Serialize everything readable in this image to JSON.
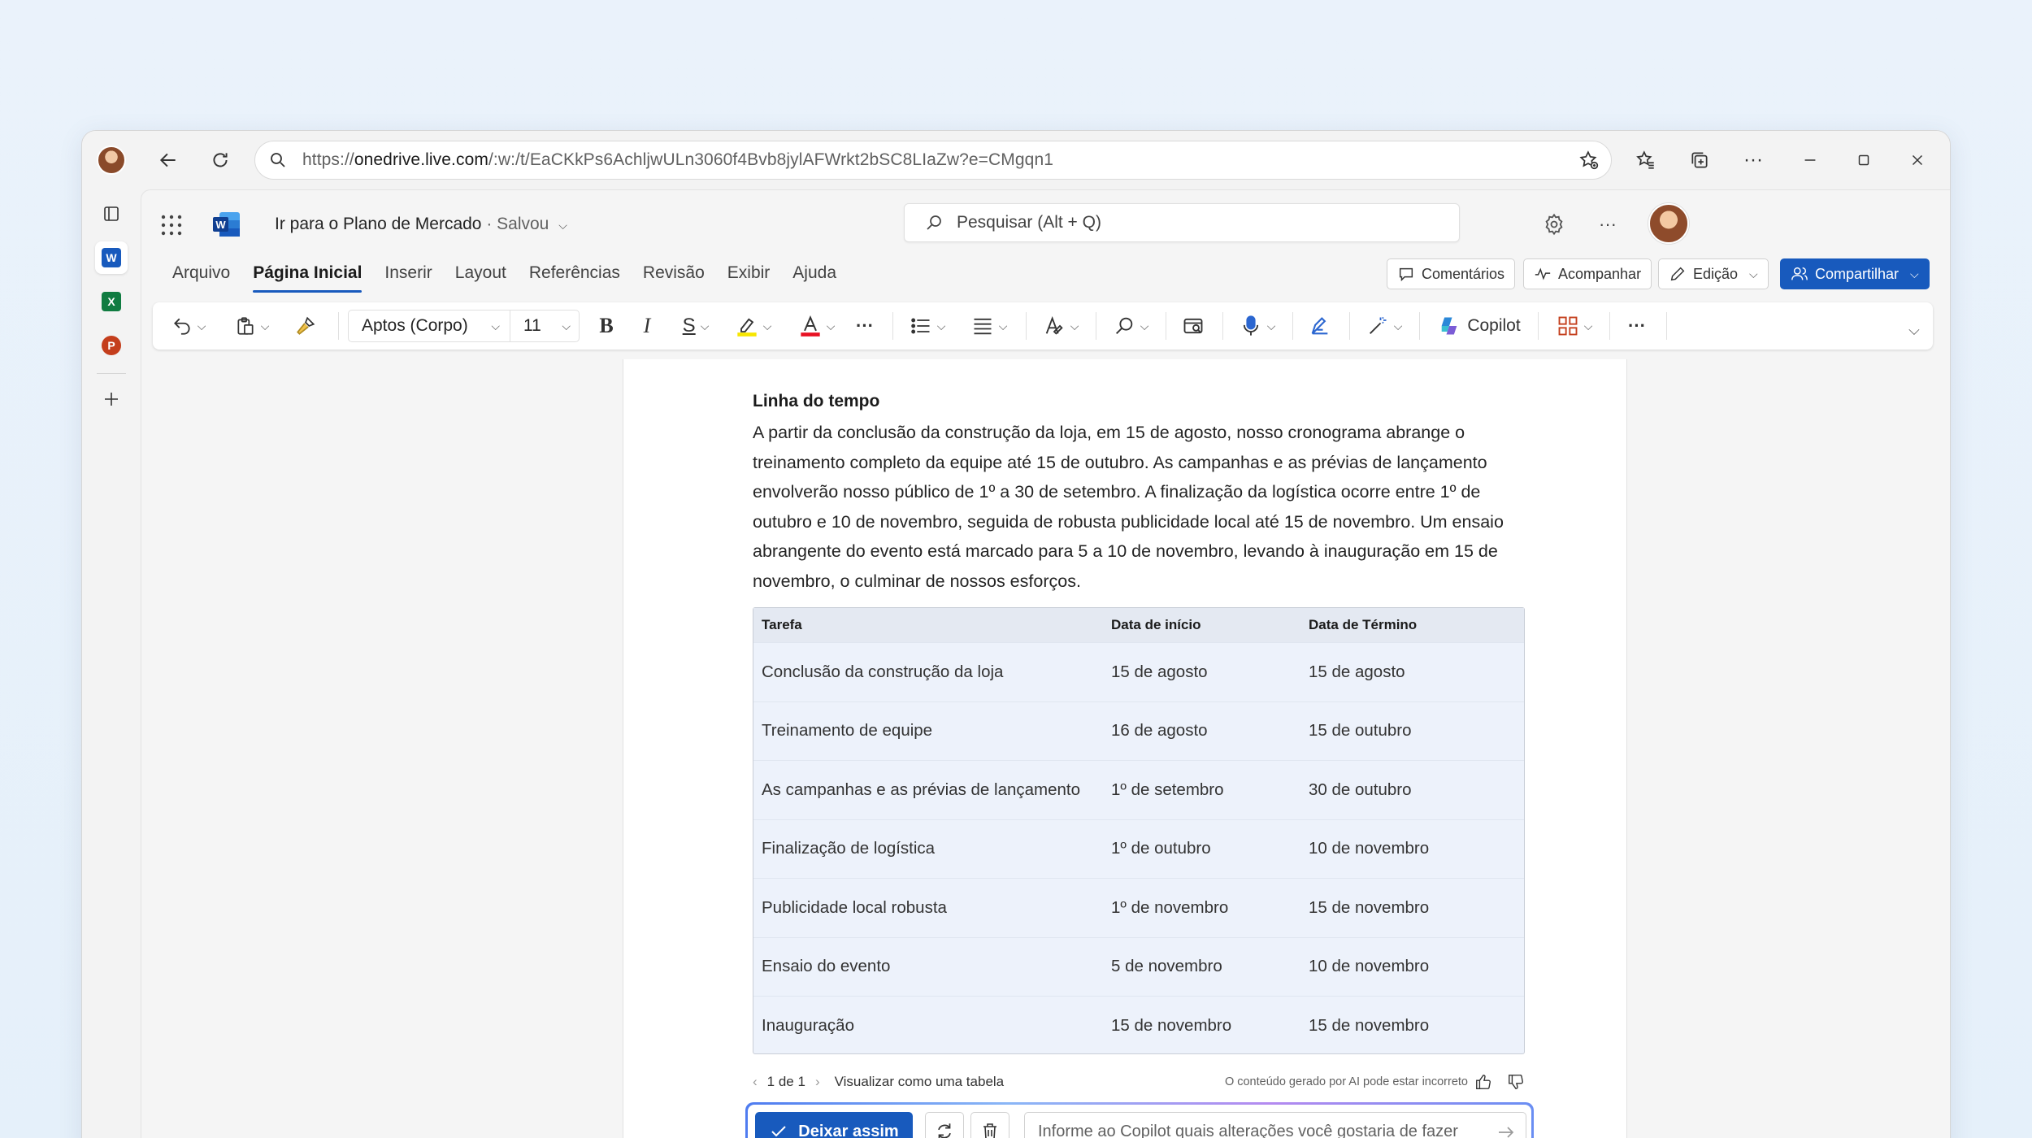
{
  "browser": {
    "url_prefix": "https://",
    "url_domain": "onedrive.live.com",
    "url_rest": "/:w:/t/EaCKkPs6AchljwULn3060f4Bvb8jylAFWrkt2bSC8LIaZw?e=CMgqn1"
  },
  "app": {
    "doc_title": "Ir para o Plano de Mercado",
    "saved_status": "· Salvou",
    "search_placeholder": "Pesquisar (Alt + Q)"
  },
  "menu": {
    "tabs": [
      "Arquivo",
      "Página Inicial",
      "Inserir",
      "Layout",
      "Referências",
      "Revisão",
      "Exibir",
      "Ajuda"
    ],
    "comments": "Comentários",
    "follow": "Acompanhar",
    "editing": "Edição",
    "share": "Compartilhar"
  },
  "toolbar": {
    "font_name": "Aptos (Corpo)",
    "font_size": "11",
    "copilot": "Copilot"
  },
  "document": {
    "heading": "Linha do tempo",
    "paragraph": "A partir da conclusão da construção da loja, em 15 de agosto, nosso cronograma abrange o treinamento completo da equipe até 15 de outubro. As campanhas e as prévias de lançamento envolverão nosso público de 1º a 30 de setembro. A finalização da logística ocorre entre 1º de outubro e 10 de novembro, seguida de robusta publicidade local até 15 de novembro. Um ensaio abrangente do evento está marcado para 5 a 10 de novembro, levando à inauguração em 15 de novembro, o culminar de nossos esforços.",
    "table": {
      "headers": [
        "Tarefa",
        "Data de início",
        "Data de Término"
      ],
      "rows": [
        [
          "Conclusão da construção da loja",
          "15 de agosto",
          "15 de agosto"
        ],
        [
          "Treinamento de equipe",
          "16 de agosto",
          "15 de outubro"
        ],
        [
          "As campanhas e as prévias de lançamento",
          "1º de setembro",
          "30 de outubro"
        ],
        [
          "Finalização de logística",
          "1º de outubro",
          "10 de novembro"
        ],
        [
          "Publicidade local robusta",
          "1º de novembro",
          "15 de novembro"
        ],
        [
          "Ensaio do evento",
          "5 de novembro",
          "10 de novembro"
        ],
        [
          "Inauguração",
          "15 de novembro",
          "15 de novembro"
        ]
      ]
    }
  },
  "copilot": {
    "pager": "1 de 1",
    "view_as_table": "Visualizar como uma tabela",
    "disclaimer": "O conteúdo gerado por AI pode estar incorreto",
    "keep_button": "Deixar assim",
    "prompt_placeholder": "Informe ao Copilot quais alterações você gostaria de fazer"
  },
  "colors": {
    "accent": "#185abd",
    "excel": "#107c41",
    "powerpoint": "#c43e1c"
  }
}
